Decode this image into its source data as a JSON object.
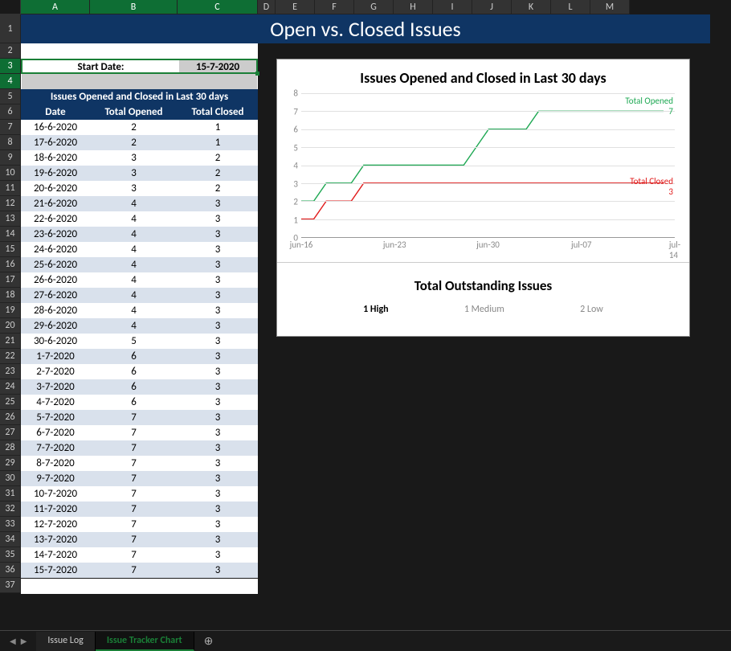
{
  "columns": [
    {
      "letter": "A",
      "w": 86,
      "sel": true
    },
    {
      "letter": "B",
      "w": 109,
      "sel": true
    },
    {
      "letter": "C",
      "w": 100,
      "sel": true
    },
    {
      "letter": "D",
      "w": 22,
      "sel": false
    },
    {
      "letter": "E",
      "w": 49,
      "sel": false
    },
    {
      "letter": "F",
      "w": 49,
      "sel": false
    },
    {
      "letter": "G",
      "w": 49,
      "sel": false
    },
    {
      "letter": "H",
      "w": 49,
      "sel": false
    },
    {
      "letter": "I",
      "w": 49,
      "sel": false
    },
    {
      "letter": "J",
      "w": 49,
      "sel": false
    },
    {
      "letter": "K",
      "w": 49,
      "sel": false
    },
    {
      "letter": "L",
      "w": 49,
      "sel": false
    },
    {
      "letter": "M",
      "w": 49,
      "sel": false
    }
  ],
  "row_numbers": {
    "first": 1,
    "last": 37,
    "tall": [
      1
    ],
    "selected": [
      3,
      4
    ]
  },
  "title": "Open vs. Closed Issues",
  "start_date": {
    "label": "Start Date:",
    "value": "15-7-2020"
  },
  "table": {
    "title": "Issues Opened and Closed in Last 30 days",
    "headers": [
      "Date",
      "Total Opened",
      "Total Closed"
    ],
    "rows": [
      [
        "16-6-2020",
        "2",
        "1"
      ],
      [
        "17-6-2020",
        "2",
        "1"
      ],
      [
        "18-6-2020",
        "3",
        "2"
      ],
      [
        "19-6-2020",
        "3",
        "2"
      ],
      [
        "20-6-2020",
        "3",
        "2"
      ],
      [
        "21-6-2020",
        "4",
        "3"
      ],
      [
        "22-6-2020",
        "4",
        "3"
      ],
      [
        "23-6-2020",
        "4",
        "3"
      ],
      [
        "24-6-2020",
        "4",
        "3"
      ],
      [
        "25-6-2020",
        "4",
        "3"
      ],
      [
        "26-6-2020",
        "4",
        "3"
      ],
      [
        "27-6-2020",
        "4",
        "3"
      ],
      [
        "28-6-2020",
        "4",
        "3"
      ],
      [
        "29-6-2020",
        "4",
        "3"
      ],
      [
        "30-6-2020",
        "5",
        "3"
      ],
      [
        "1-7-2020",
        "6",
        "3"
      ],
      [
        "2-7-2020",
        "6",
        "3"
      ],
      [
        "3-7-2020",
        "6",
        "3"
      ],
      [
        "4-7-2020",
        "6",
        "3"
      ],
      [
        "5-7-2020",
        "7",
        "3"
      ],
      [
        "6-7-2020",
        "7",
        "3"
      ],
      [
        "7-7-2020",
        "7",
        "3"
      ],
      [
        "8-7-2020",
        "7",
        "3"
      ],
      [
        "9-7-2020",
        "7",
        "3"
      ],
      [
        "10-7-2020",
        "7",
        "3"
      ],
      [
        "11-7-2020",
        "7",
        "3"
      ],
      [
        "12-7-2020",
        "7",
        "3"
      ],
      [
        "13-7-2020",
        "7",
        "3"
      ],
      [
        "14-7-2020",
        "7",
        "3"
      ],
      [
        "15-7-2020",
        "7",
        "3"
      ]
    ]
  },
  "chart_data": {
    "type": "line",
    "title": "Issues Opened and Closed in Last 30 days",
    "ylabel": "",
    "xlabel": "",
    "ylim": [
      0,
      8
    ],
    "yticks": [
      0,
      1,
      2,
      3,
      4,
      5,
      6,
      7,
      8
    ],
    "xticks": [
      "jun-16",
      "jun-23",
      "jun-30",
      "jul-07",
      "jul-14"
    ],
    "x": [
      "16-6",
      "17-6",
      "18-6",
      "19-6",
      "20-6",
      "21-6",
      "22-6",
      "23-6",
      "24-6",
      "25-6",
      "26-6",
      "27-6",
      "28-6",
      "29-6",
      "30-6",
      "1-7",
      "2-7",
      "3-7",
      "4-7",
      "5-7",
      "6-7",
      "7-7",
      "8-7",
      "9-7",
      "10-7",
      "11-7",
      "12-7",
      "13-7",
      "14-7",
      "15-7"
    ],
    "series": [
      {
        "name": "Total Opened",
        "color": "#1ea853",
        "values": [
          2,
          2,
          3,
          3,
          3,
          4,
          4,
          4,
          4,
          4,
          4,
          4,
          4,
          4,
          5,
          6,
          6,
          6,
          6,
          7,
          7,
          7,
          7,
          7,
          7,
          7,
          7,
          7,
          7,
          7
        ],
        "end_label": "7"
      },
      {
        "name": "Total Closed",
        "color": "#e11b1b",
        "values": [
          1,
          1,
          2,
          2,
          2,
          3,
          3,
          3,
          3,
          3,
          3,
          3,
          3,
          3,
          3,
          3,
          3,
          3,
          3,
          3,
          3,
          3,
          3,
          3,
          3,
          3,
          3,
          3,
          3,
          3
        ],
        "end_label": "3"
      }
    ]
  },
  "outstanding": {
    "title": "Total Outstanding Issues",
    "items": [
      {
        "text": "1 High",
        "bold": true
      },
      {
        "text": "1 Medium",
        "bold": false
      },
      {
        "text": "2 Low",
        "bold": false
      }
    ]
  },
  "tabs": {
    "items": [
      "Issue Log",
      "Issue Tracker Chart"
    ],
    "active": 1
  },
  "colors": {
    "accent": "#0f3564",
    "selection": "#1a7f37"
  }
}
